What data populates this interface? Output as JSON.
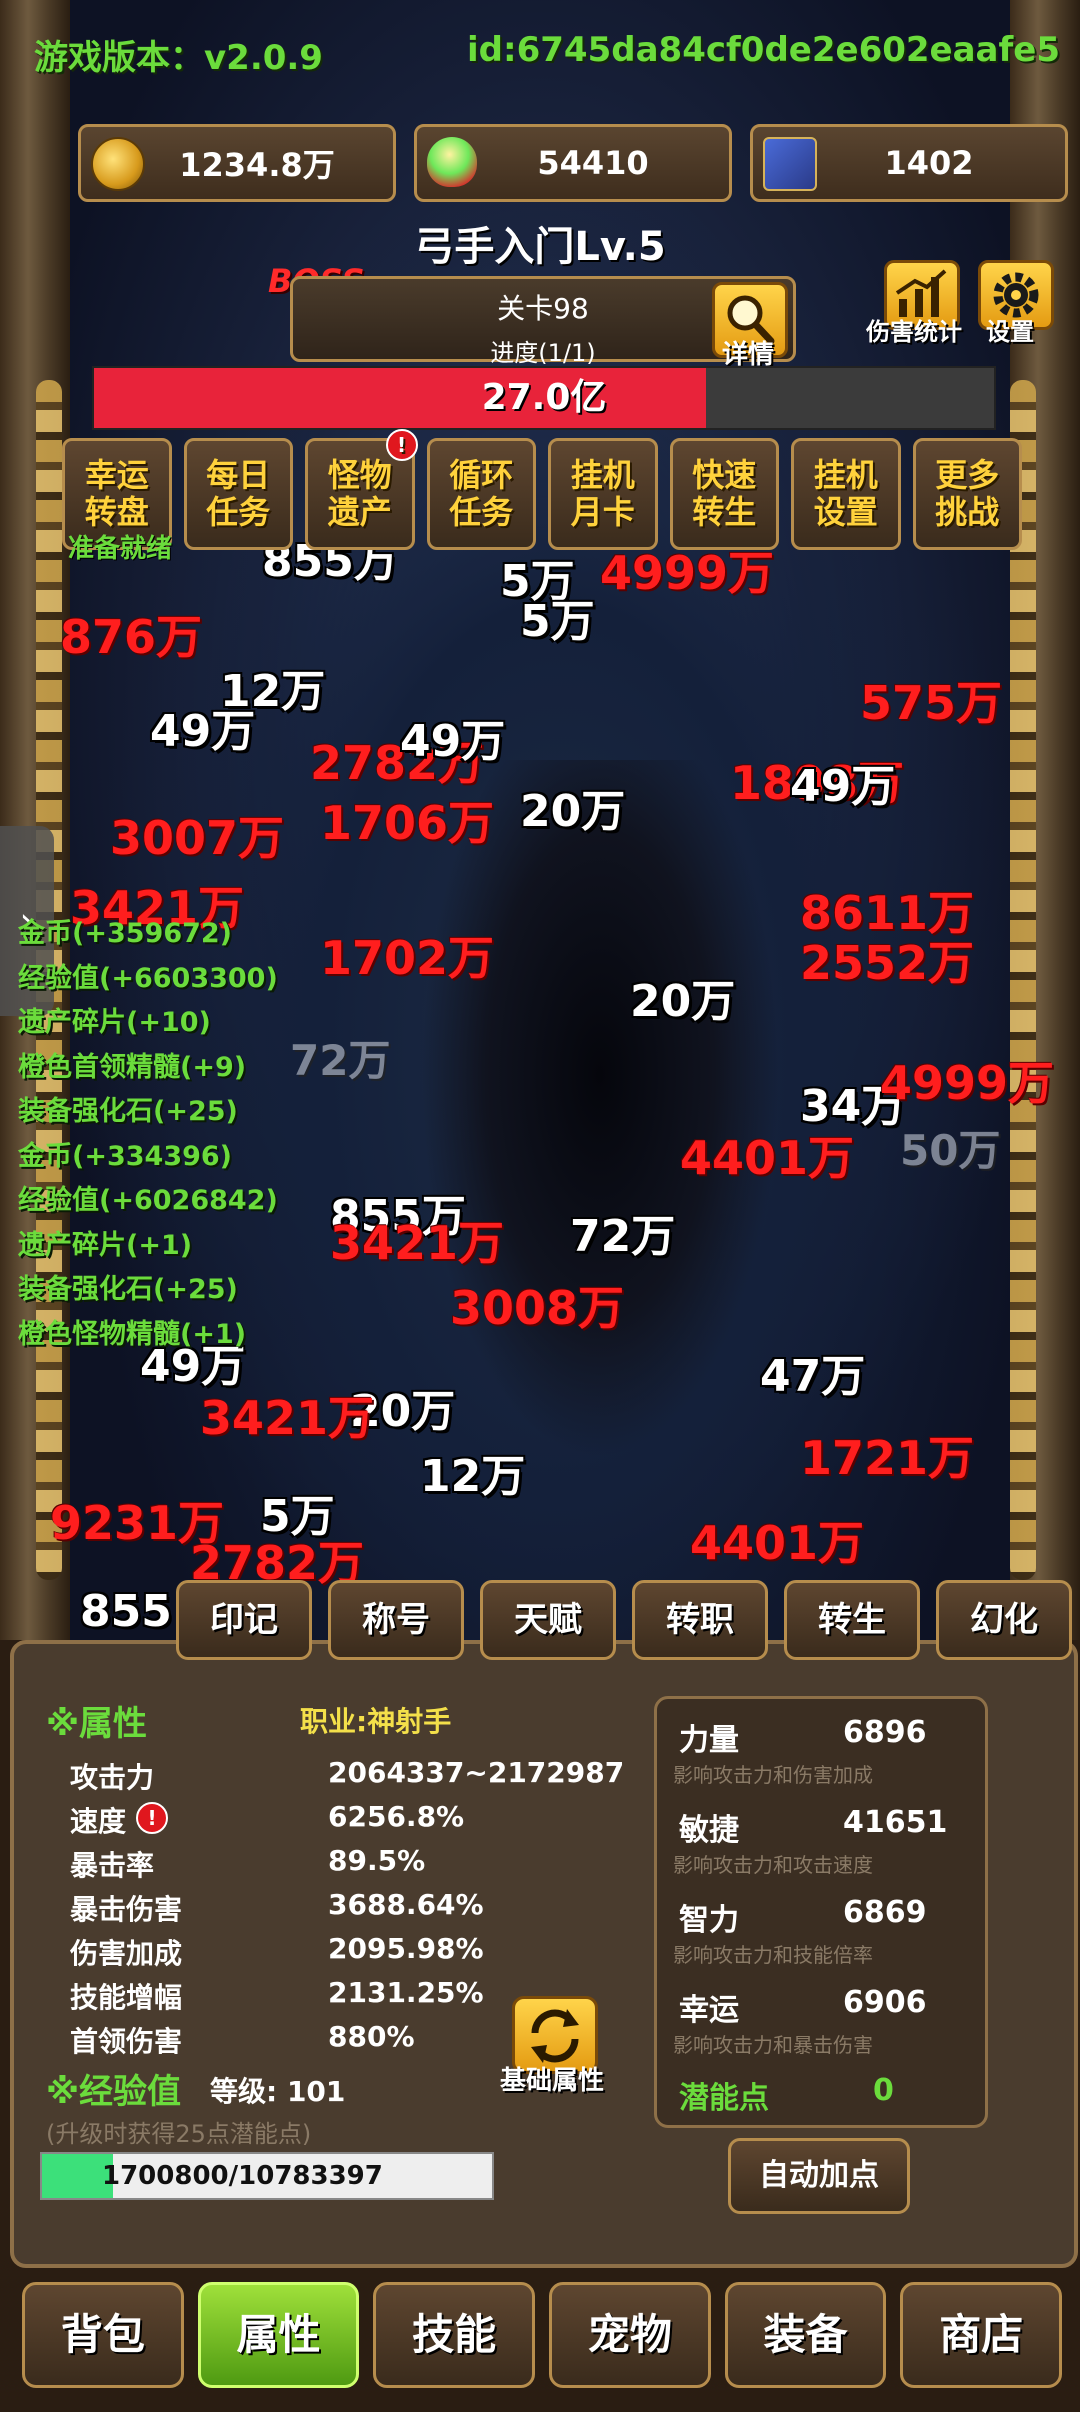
{
  "header": {
    "version": "游戏版本：v2.0.9",
    "user_id": "id:6745da84cf0de2e602eaafe5"
  },
  "resources": [
    {
      "icon": "coin-icon",
      "value": "1234.8万"
    },
    {
      "icon": "gem-icon",
      "value": "54410"
    },
    {
      "icon": "card-icon",
      "value": "1402"
    }
  ],
  "stage": {
    "title": "弓手入门Lv.5",
    "boss_label": "BOSS",
    "level": "关卡98",
    "progress": "进度(1/1)",
    "detail_label": "详情",
    "damage_stats_label": "伤害统计",
    "settings_label": "设置"
  },
  "boss_hp": {
    "text": "27.0亿",
    "fraction": 0.68
  },
  "functions": [
    {
      "label": "幸运\n转盘",
      "alert": false
    },
    {
      "label": "每日\n任务",
      "alert": false
    },
    {
      "label": "怪物\n遗产",
      "alert": true
    },
    {
      "label": "循环\n任务",
      "alert": false
    },
    {
      "label": "挂机\n月卡",
      "alert": false
    },
    {
      "label": "快速\n转生",
      "alert": false
    },
    {
      "label": "挂机\n设置",
      "alert": false
    },
    {
      "label": "更多\n挑战",
      "alert": false
    }
  ],
  "alert_glyph": "!",
  "ready_text": "准备就绪",
  "side_tab_glyph": "›",
  "battle": {
    "damage_numbers": [
      {
        "t": "855万",
        "c": "white"
      },
      {
        "t": "5万",
        "c": "white"
      },
      {
        "t": "4999万",
        "c": "red"
      },
      {
        "t": "5万",
        "c": "white"
      },
      {
        "t": "876万",
        "c": "red"
      },
      {
        "t": "12万",
        "c": "white"
      },
      {
        "t": "49万",
        "c": "white"
      },
      {
        "t": "2782万",
        "c": "red"
      },
      {
        "t": "49万",
        "c": "white"
      },
      {
        "t": "1898万",
        "c": "red"
      },
      {
        "t": "49万",
        "c": "white"
      },
      {
        "t": "575万",
        "c": "red"
      },
      {
        "t": "20万",
        "c": "white"
      },
      {
        "t": "3007万",
        "c": "red"
      },
      {
        "t": "1706万",
        "c": "red"
      },
      {
        "t": "3421万",
        "c": "red"
      },
      {
        "t": "1702万",
        "c": "red"
      },
      {
        "t": "8611万",
        "c": "red"
      },
      {
        "t": "2552万",
        "c": "red"
      },
      {
        "t": "20万",
        "c": "white"
      },
      {
        "t": "72万",
        "c": "grey"
      },
      {
        "t": "34万",
        "c": "white"
      },
      {
        "t": "4999万",
        "c": "red"
      },
      {
        "t": "4401万",
        "c": "red"
      },
      {
        "t": "50万",
        "c": "grey"
      },
      {
        "t": "855万",
        "c": "white"
      },
      {
        "t": "72万",
        "c": "white"
      },
      {
        "t": "3421万",
        "c": "red"
      },
      {
        "t": "3008万",
        "c": "red"
      },
      {
        "t": "47万",
        "c": "white"
      },
      {
        "t": "49万",
        "c": "white"
      },
      {
        "t": "20万",
        "c": "white"
      },
      {
        "t": "3421万",
        "c": "red"
      },
      {
        "t": "1721万",
        "c": "red"
      },
      {
        "t": "12万",
        "c": "white"
      },
      {
        "t": "5万",
        "c": "white"
      },
      {
        "t": "9231万",
        "c": "red"
      },
      {
        "t": "2782万",
        "c": "red"
      },
      {
        "t": "4401万",
        "c": "red"
      },
      {
        "t": "855",
        "c": "white"
      }
    ]
  },
  "log": [
    "金币(+359672)",
    "经验值(+6603300)",
    "遗产碎片(+10)",
    "橙色首领精髓(+9)",
    "装备强化石(+25)",
    "金币(+334396)",
    "经验值(+6026842)",
    "遗产碎片(+1)",
    "装备强化石(+25)",
    "橙色怪物精髓(+1)"
  ],
  "panel_tabs": [
    "印记",
    "称号",
    "天赋",
    "转职",
    "转生",
    "幻化"
  ],
  "attributes": {
    "title": "※属性",
    "job": "职业:神射手",
    "rows": [
      {
        "k": "攻击力",
        "v": "2064337~2172987",
        "alert": false
      },
      {
        "k": "速度",
        "v": "6256.8%",
        "alert": true
      },
      {
        "k": "暴击率",
        "v": "89.5%",
        "alert": false
      },
      {
        "k": "暴击伤害",
        "v": "3688.64%",
        "alert": false
      },
      {
        "k": "伤害加成",
        "v": "2095.98%",
        "alert": false
      },
      {
        "k": "技能增幅",
        "v": "2131.25%",
        "alert": false
      },
      {
        "k": "首领伤害",
        "v": "880%",
        "alert": false
      }
    ]
  },
  "experience": {
    "title": "※经验值",
    "level": "等级: 101",
    "hint": "(升级时获得25点潜能点)",
    "text": "1700800/10783397",
    "fraction": 0.158
  },
  "swap_label": "基础属性",
  "base_attrs": [
    {
      "name": "力量",
      "value": "6896",
      "desc": "影响攻击力和伤害加成"
    },
    {
      "name": "敏捷",
      "value": "41651",
      "desc": "影响攻击力和攻击速度"
    },
    {
      "name": "智力",
      "value": "6869",
      "desc": "影响攻击力和技能倍率"
    },
    {
      "name": "幸运",
      "value": "6906",
      "desc": "影响攻击力和暴击伤害"
    }
  ],
  "potential": {
    "label": "潜能点",
    "value": "0"
  },
  "auto_add_label": "自动加点",
  "bottom_nav": [
    {
      "label": "背包",
      "active": false
    },
    {
      "label": "属性",
      "active": true
    },
    {
      "label": "技能",
      "active": false
    },
    {
      "label": "宠物",
      "active": false
    },
    {
      "label": "装备",
      "active": false
    },
    {
      "label": "商店",
      "active": false
    }
  ],
  "colors": {
    "accent_green": "#6bdc3c",
    "damage_red": "#ff1e1e",
    "hp_red": "#e8233a",
    "gold": "#ffd23c"
  }
}
